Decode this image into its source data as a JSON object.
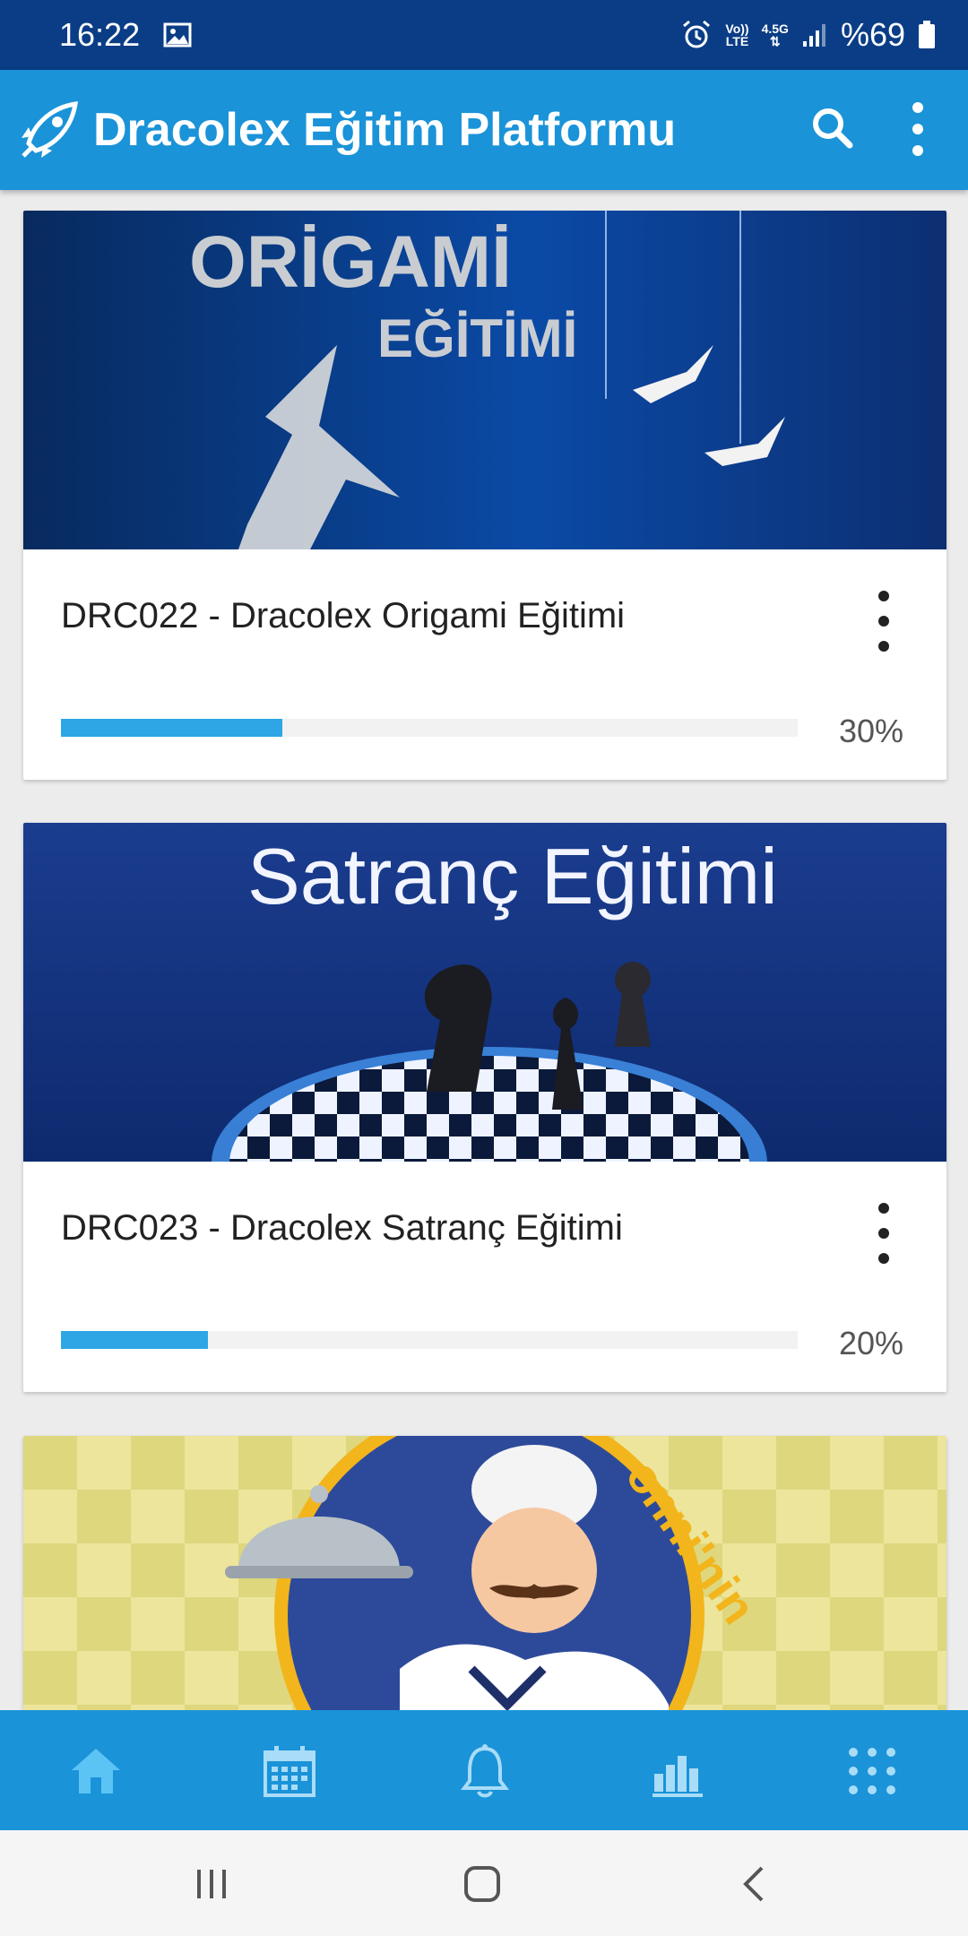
{
  "status_bar": {
    "time": "16:22",
    "volte_label": "Vo))\nLTE",
    "network_label": "4.5G",
    "battery_percent": "%69"
  },
  "app_bar": {
    "title": "Dracolex Eğitim Platformu",
    "icons": [
      "rocket-logo-icon",
      "search-icon",
      "more-vert-icon"
    ]
  },
  "courses": [
    {
      "title": "DRC022 - Dracolex Origami Eğitimi",
      "banner_text_1": "ORİGAMİ",
      "banner_text_2": "EĞİTİMİ",
      "progress": 0.3,
      "progress_label": "30%"
    },
    {
      "title": "DRC023 - Dracolex Satranç Eğitimi",
      "banner_text_1": "Satranç Eğitimi",
      "progress": 0.2,
      "progress_label": "20%"
    },
    {
      "banner_text_1": "onni'nin",
      "banner_theme": "chef"
    }
  ],
  "bottom_nav": {
    "items": [
      "home-icon",
      "calendar-icon",
      "bell-icon",
      "stats-icon",
      "apps-grid-icon"
    ],
    "active_color": "#5cc4f5",
    "inactive_color": "#a9dcf7"
  },
  "colors": {
    "status_bar": "#0a3d86",
    "app_bar": "#1a93d8",
    "progress_fill": "#2ea6e6"
  }
}
